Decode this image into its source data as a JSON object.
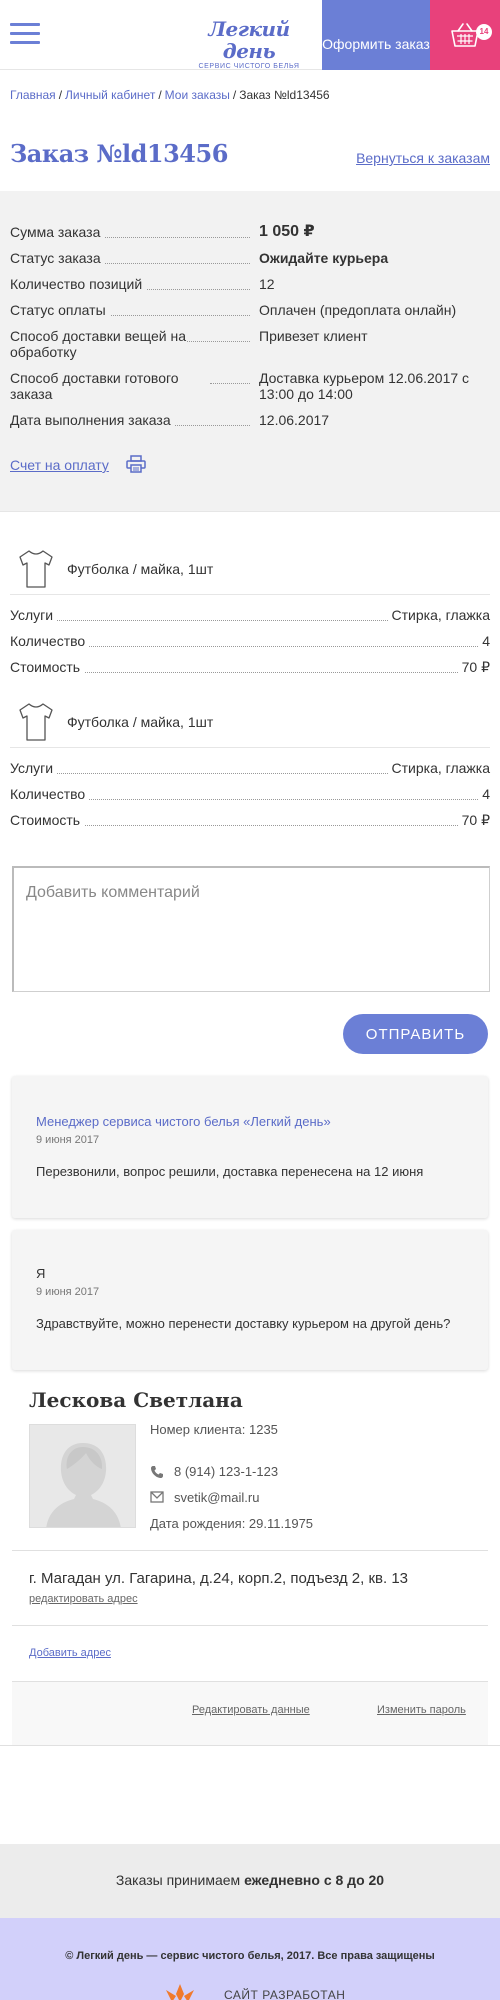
{
  "header": {
    "logo_name": "Легкий день",
    "logo_sub": "сервис чистого белья",
    "order_button": "Оформить заказ",
    "cart_count": "14"
  },
  "breadcrumb": {
    "items": [
      "Главная",
      "Личный кабинет",
      "Мои заказы"
    ],
    "current": "Заказ №ld13456",
    "separator": "/"
  },
  "order": {
    "title": "Заказ №ld13456",
    "back_link": "Вернуться к заказам",
    "summary": [
      {
        "label": "Сумма заказа",
        "value": "1 050 ₽"
      },
      {
        "label": "Статус заказа",
        "value": "Ожидайте курьера"
      },
      {
        "label": "Количество позиций",
        "value": "12"
      },
      {
        "label": "Статус оплаты",
        "value": "Оплачен (предоплата онлайн)"
      },
      {
        "label": "Способ доставки вещей на обработку",
        "value": "Привезет клиент"
      },
      {
        "label": "Способ доставки готового заказа",
        "value": "Доставка курьером 12.06.2017 с 13:00 до 14:00"
      },
      {
        "label": "Дата выполнения заказа",
        "value": "12.06.2017"
      }
    ],
    "invoice_link": "Счет на оплату"
  },
  "items": [
    {
      "name": "Футболка / майка, 1шт",
      "rows": [
        {
          "label": "Услуги",
          "value": "Стирка, глажка"
        },
        {
          "label": "Количество",
          "value": "4"
        },
        {
          "label": "Стоимость",
          "value": "70 ₽"
        }
      ]
    },
    {
      "name": "Футболка / майка, 1шт",
      "rows": [
        {
          "label": "Услуги",
          "value": "Стирка, глажка"
        },
        {
          "label": "Количество",
          "value": "4"
        },
        {
          "label": "Стоимость",
          "value": "70 ₽"
        }
      ]
    }
  ],
  "comment": {
    "placeholder": "Добавить комментарий",
    "send_button": "ОТПРАВИТЬ"
  },
  "messages": [
    {
      "author": "Менеджер сервиса чистого белья «Легкий день»",
      "date": "9 июня 2017",
      "text": "Перезвонили, вопрос решили, доставка перенесена на 12 июня"
    },
    {
      "author": "Я",
      "date": "9 июня 2017",
      "text": "Здравствуйте, можно перенести доставку курьером на другой день?"
    }
  ],
  "profile": {
    "name": "Лескова Светлана",
    "client_number": "Номер клиента: 1235",
    "phone": "8 (914) 123-1-123",
    "email": "svetik@mail.ru",
    "birthdate": "Дата рождения: 29.11.1975",
    "address": "г. Магадан ул. Гагарина, д.24, корп.2, подъезд 2, кв. 13",
    "edit_address": "редактировать адрес",
    "add_address": "Добавить адрес",
    "edit_data": "Редактировать данные",
    "change_password": "Изменить пароль"
  },
  "footer": {
    "hours_prefix": "Заказы  принимаем",
    "hours_bold": "ежедневно с 8 до 20",
    "copyright": "© Легкий день — сервис чистого белья, 2017. Все права защищены",
    "developer": "САЙТ РАЗРАБОТАН"
  },
  "colors": {
    "accent": "#6b7fd6",
    "link": "#5b6cc8",
    "cart": "#e8417b",
    "summary_bg": "#f2f2f2",
    "footer_bg": "#d2d0fa"
  }
}
